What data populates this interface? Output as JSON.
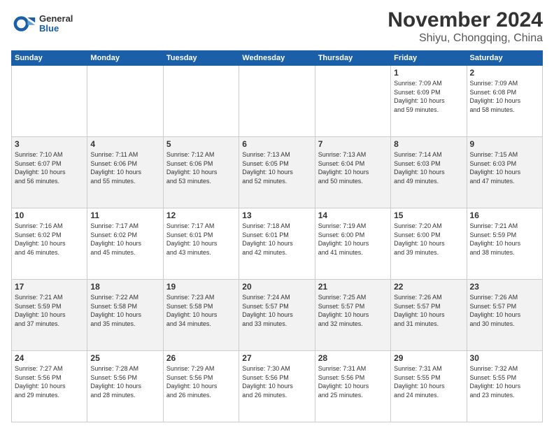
{
  "logo": {
    "general": "General",
    "blue": "Blue"
  },
  "title": "November 2024",
  "location": "Shiyu, Chongqing, China",
  "weekdays": [
    "Sunday",
    "Monday",
    "Tuesday",
    "Wednesday",
    "Thursday",
    "Friday",
    "Saturday"
  ],
  "weeks": [
    [
      {
        "day": "",
        "info": ""
      },
      {
        "day": "",
        "info": ""
      },
      {
        "day": "",
        "info": ""
      },
      {
        "day": "",
        "info": ""
      },
      {
        "day": "",
        "info": ""
      },
      {
        "day": "1",
        "info": "Sunrise: 7:09 AM\nSunset: 6:09 PM\nDaylight: 10 hours\nand 59 minutes."
      },
      {
        "day": "2",
        "info": "Sunrise: 7:09 AM\nSunset: 6:08 PM\nDaylight: 10 hours\nand 58 minutes."
      }
    ],
    [
      {
        "day": "3",
        "info": "Sunrise: 7:10 AM\nSunset: 6:07 PM\nDaylight: 10 hours\nand 56 minutes."
      },
      {
        "day": "4",
        "info": "Sunrise: 7:11 AM\nSunset: 6:06 PM\nDaylight: 10 hours\nand 55 minutes."
      },
      {
        "day": "5",
        "info": "Sunrise: 7:12 AM\nSunset: 6:06 PM\nDaylight: 10 hours\nand 53 minutes."
      },
      {
        "day": "6",
        "info": "Sunrise: 7:13 AM\nSunset: 6:05 PM\nDaylight: 10 hours\nand 52 minutes."
      },
      {
        "day": "7",
        "info": "Sunrise: 7:13 AM\nSunset: 6:04 PM\nDaylight: 10 hours\nand 50 minutes."
      },
      {
        "day": "8",
        "info": "Sunrise: 7:14 AM\nSunset: 6:03 PM\nDaylight: 10 hours\nand 49 minutes."
      },
      {
        "day": "9",
        "info": "Sunrise: 7:15 AM\nSunset: 6:03 PM\nDaylight: 10 hours\nand 47 minutes."
      }
    ],
    [
      {
        "day": "10",
        "info": "Sunrise: 7:16 AM\nSunset: 6:02 PM\nDaylight: 10 hours\nand 46 minutes."
      },
      {
        "day": "11",
        "info": "Sunrise: 7:17 AM\nSunset: 6:02 PM\nDaylight: 10 hours\nand 45 minutes."
      },
      {
        "day": "12",
        "info": "Sunrise: 7:17 AM\nSunset: 6:01 PM\nDaylight: 10 hours\nand 43 minutes."
      },
      {
        "day": "13",
        "info": "Sunrise: 7:18 AM\nSunset: 6:01 PM\nDaylight: 10 hours\nand 42 minutes."
      },
      {
        "day": "14",
        "info": "Sunrise: 7:19 AM\nSunset: 6:00 PM\nDaylight: 10 hours\nand 41 minutes."
      },
      {
        "day": "15",
        "info": "Sunrise: 7:20 AM\nSunset: 6:00 PM\nDaylight: 10 hours\nand 39 minutes."
      },
      {
        "day": "16",
        "info": "Sunrise: 7:21 AM\nSunset: 5:59 PM\nDaylight: 10 hours\nand 38 minutes."
      }
    ],
    [
      {
        "day": "17",
        "info": "Sunrise: 7:21 AM\nSunset: 5:59 PM\nDaylight: 10 hours\nand 37 minutes."
      },
      {
        "day": "18",
        "info": "Sunrise: 7:22 AM\nSunset: 5:58 PM\nDaylight: 10 hours\nand 35 minutes."
      },
      {
        "day": "19",
        "info": "Sunrise: 7:23 AM\nSunset: 5:58 PM\nDaylight: 10 hours\nand 34 minutes."
      },
      {
        "day": "20",
        "info": "Sunrise: 7:24 AM\nSunset: 5:57 PM\nDaylight: 10 hours\nand 33 minutes."
      },
      {
        "day": "21",
        "info": "Sunrise: 7:25 AM\nSunset: 5:57 PM\nDaylight: 10 hours\nand 32 minutes."
      },
      {
        "day": "22",
        "info": "Sunrise: 7:26 AM\nSunset: 5:57 PM\nDaylight: 10 hours\nand 31 minutes."
      },
      {
        "day": "23",
        "info": "Sunrise: 7:26 AM\nSunset: 5:57 PM\nDaylight: 10 hours\nand 30 minutes."
      }
    ],
    [
      {
        "day": "24",
        "info": "Sunrise: 7:27 AM\nSunset: 5:56 PM\nDaylight: 10 hours\nand 29 minutes."
      },
      {
        "day": "25",
        "info": "Sunrise: 7:28 AM\nSunset: 5:56 PM\nDaylight: 10 hours\nand 28 minutes."
      },
      {
        "day": "26",
        "info": "Sunrise: 7:29 AM\nSunset: 5:56 PM\nDaylight: 10 hours\nand 26 minutes."
      },
      {
        "day": "27",
        "info": "Sunrise: 7:30 AM\nSunset: 5:56 PM\nDaylight: 10 hours\nand 26 minutes."
      },
      {
        "day": "28",
        "info": "Sunrise: 7:31 AM\nSunset: 5:56 PM\nDaylight: 10 hours\nand 25 minutes."
      },
      {
        "day": "29",
        "info": "Sunrise: 7:31 AM\nSunset: 5:55 PM\nDaylight: 10 hours\nand 24 minutes."
      },
      {
        "day": "30",
        "info": "Sunrise: 7:32 AM\nSunset: 5:55 PM\nDaylight: 10 hours\nand 23 minutes."
      }
    ]
  ],
  "alt_rows": [
    1,
    3
  ],
  "colors": {
    "header_bg": "#1a5fa8",
    "alt_row_bg": "#f2f2f2",
    "text": "#333333"
  }
}
